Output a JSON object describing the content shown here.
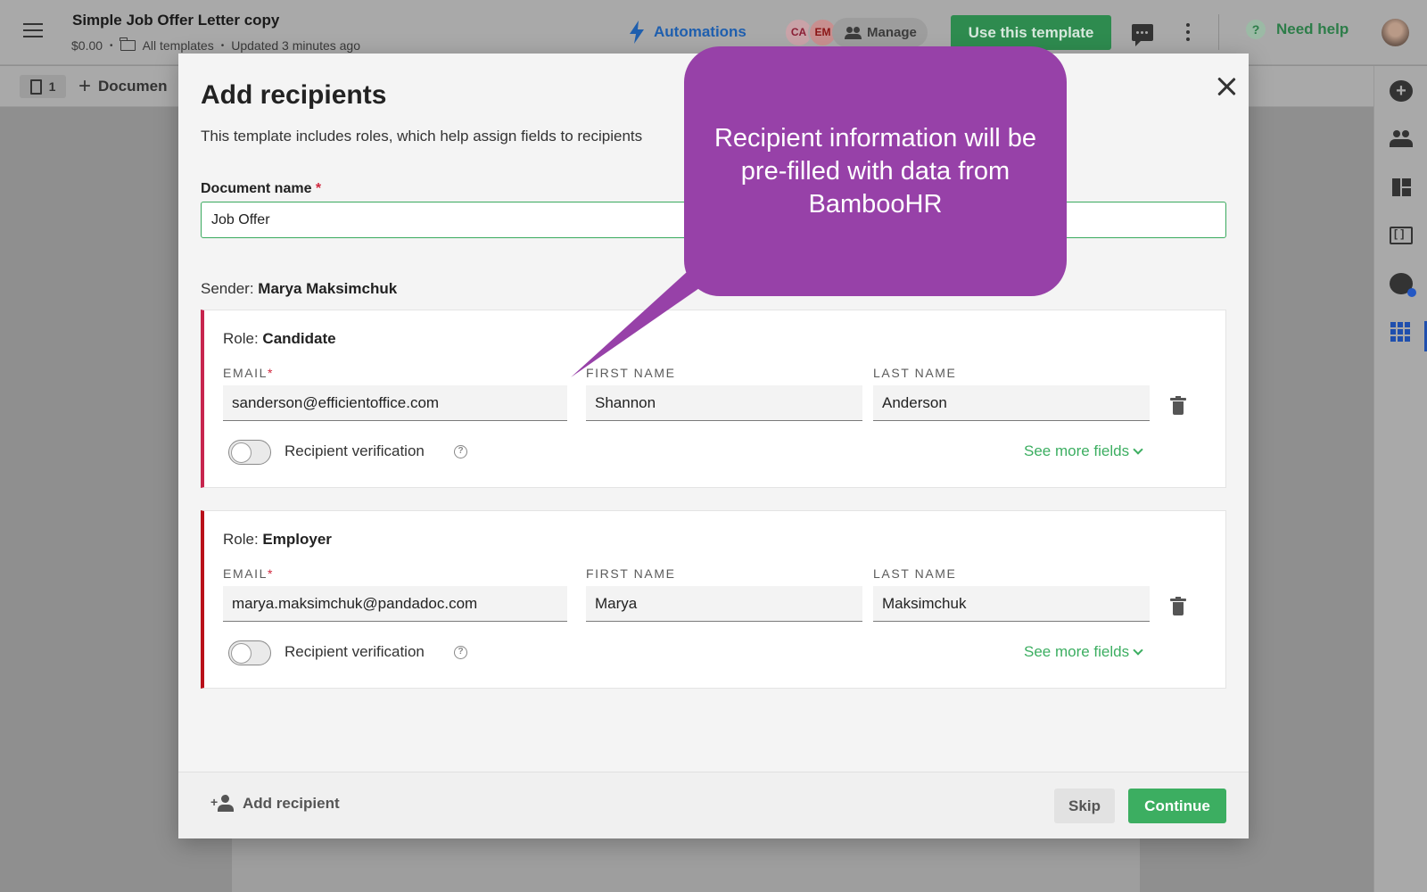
{
  "header": {
    "doc_title": "Simple Job Offer Letter copy",
    "price": "$0.00",
    "folder": "All templates",
    "updated": "Updated 3 minutes ago",
    "automations_label": "Automations",
    "avatar_ca": "CA",
    "avatar_em": "EM",
    "manage_label": "Manage",
    "use_template_label": "Use this template",
    "need_help_label": "Need help"
  },
  "toolbar": {
    "pages_count": "1",
    "add_document_label": "Documen"
  },
  "modal": {
    "title": "Add recipients",
    "description": "This template includes roles, which help assign fields to recipients",
    "document_name_label": "Document name",
    "required_mark": "*",
    "document_name_value": "Job Offer",
    "sender_label": "Sender:",
    "sender_name": "Marya Maksimchuk",
    "role_prefix": "Role:",
    "email_label": "EMAIL",
    "first_name_label": "FIRST NAME",
    "last_name_label": "LAST NAME",
    "verification_label": "Recipient verification",
    "see_more_label": "See more fields",
    "roles": [
      {
        "name": "Candidate",
        "email": "sanderson@efficientoffice.com",
        "first_name": "Shannon",
        "last_name": "Anderson",
        "accent": "#c7254e"
      },
      {
        "name": "Employer",
        "email": "marya.maksimchuk@pandadoc.com",
        "first_name": "Marya",
        "last_name": "Maksimchuk",
        "accent": "#b9101a"
      }
    ],
    "footer": {
      "add_recipient_label": "Add recipient",
      "skip_label": "Skip",
      "continue_label": "Continue"
    }
  },
  "callout": {
    "text": "Recipient information will be pre-filled with data from BambooHR",
    "color": "#9741a8"
  },
  "colors": {
    "primary_green": "#3cae61",
    "automations_blue": "#1f5fae",
    "callout_purple": "#9741a8"
  }
}
